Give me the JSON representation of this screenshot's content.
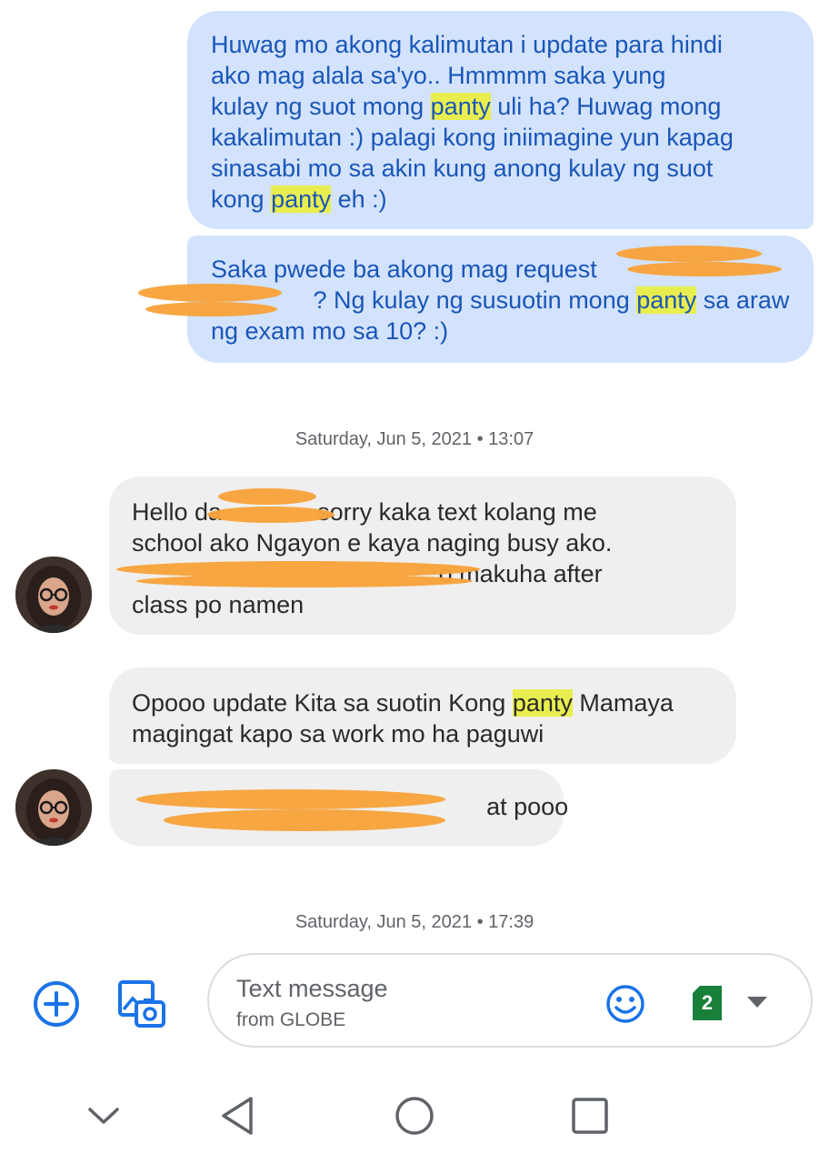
{
  "messages": [
    {
      "direction": "outgoing",
      "lines": [
        [
          {
            "t": "Huwag mo akong kalimutan i update para hindi"
          }
        ],
        [
          {
            "t": "ako mag alala sa'yo.. Hmmmm saka yung"
          }
        ],
        [
          {
            "t": "kulay ng suot mong "
          },
          {
            "t": "panty",
            "hl": true
          },
          {
            "t": " uli ha? Huwag mong"
          }
        ],
        [
          {
            "t": "kakalimutan :) palagi kong iniimagine yun kapag"
          }
        ],
        [
          {
            "t": "sinasabi mo sa akin kung anong kulay ng suot"
          }
        ],
        [
          {
            "t": "kong "
          },
          {
            "t": "panty",
            "hl": true
          },
          {
            "t": " eh :)"
          }
        ]
      ]
    },
    {
      "direction": "outgoing",
      "lines": [
        [
          {
            "t": "Saka pwede ba akong mag request "
          }
        ],
        [
          {
            "t": "               ? Ng kulay ng susuotin mong "
          },
          {
            "t": "panty",
            "hl": true
          },
          {
            "t": " sa araw"
          }
        ],
        [
          {
            "t": "ng exam mo sa 10? :)"
          }
        ]
      ]
    },
    {
      "direction": "incoming",
      "lines": [
        [
          {
            "t": "Hello da"
          },
          {
            "t": "              "
          },
          {
            "t": "sorry kaka text kolang me"
          }
        ],
        [
          {
            "t": "school ako Ngayon e kaya naging busy ako."
          }
        ],
        [
          {
            "t": "                                             o makuha after"
          }
        ],
        [
          {
            "t": "class po namen"
          }
        ]
      ]
    },
    {
      "direction": "incoming",
      "lines": [
        [
          {
            "t": "Opooo update Kita sa suotin Kong "
          },
          {
            "t": "panty",
            "hl": true
          },
          {
            "t": " Mamaya"
          }
        ],
        [
          {
            "t": "magingat kapo sa work mo ha paguwi"
          }
        ]
      ]
    },
    {
      "direction": "incoming",
      "lines": [
        [
          {
            "t": "                                                    at pooo"
          }
        ]
      ]
    }
  ],
  "timestamps": [
    "Saturday, Jun 5, 2021 • 13:07",
    "Saturday, Jun 5, 2021 • 17:39"
  ],
  "composer": {
    "placeholder": "Text message",
    "carrier": "from GLOBE",
    "sim_number": "2"
  },
  "icons": {
    "add": "add-circle-icon",
    "gallery": "gallery-camera-icon",
    "emoji": "emoji-icon",
    "sim": "sim-card-icon",
    "dropdown": "dropdown-arrow-icon",
    "nav_down": "chevron-down-icon",
    "nav_back": "back-triangle-icon",
    "nav_home": "home-circle-icon",
    "nav_recents": "recents-square-icon"
  },
  "colors": {
    "outgoing_bubble": "#d3e3fd",
    "outgoing_text": "#1a56b8",
    "incoming_bubble": "#efefef",
    "highlight": "#e9ee4f",
    "accent_blue": "#1a73e8",
    "sim_green": "#188038",
    "redaction": "#f7a23a"
  }
}
